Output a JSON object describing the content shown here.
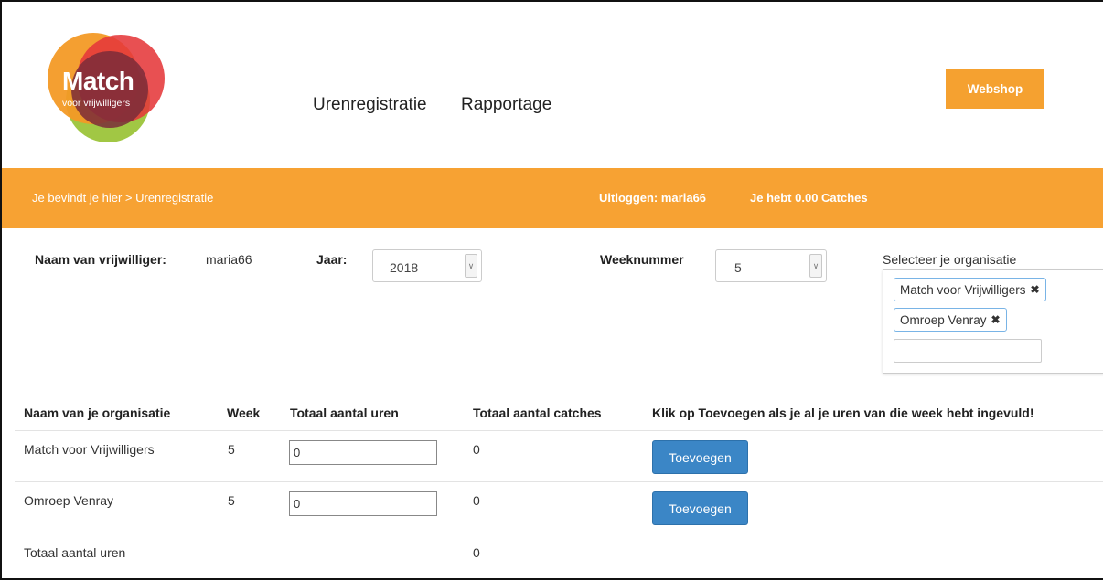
{
  "logo": {
    "main": "Match",
    "sub": "voor vrijwilligers"
  },
  "nav": {
    "items": [
      "Urenregistratie",
      "Rapportage"
    ]
  },
  "webshop_label": "Webshop",
  "bar": {
    "breadcrumb": "Je bevindt je hier > Urenregistratie",
    "logout": "Uitloggen: maria66",
    "catches": "Je hebt 0.00 Catches"
  },
  "form": {
    "volunteer_label": "Naam van vrijwilliger:",
    "volunteer_value": "maria66",
    "year_label": "Jaar:",
    "year_value": "2018",
    "week_label": "Weeknummer",
    "week_value": "5",
    "org_label": "Selecteer je organisatie",
    "org_tags": [
      "Match voor Vrijwilligers",
      "Omroep Venray"
    ]
  },
  "table": {
    "headers": [
      "Naam van je organisatie",
      "Week",
      "Totaal aantal uren",
      "Totaal aantal catches",
      "Klik op Toevoegen als je al je uren van die week hebt ingevuld!"
    ],
    "rows": [
      {
        "org": "Match voor Vrijwilligers",
        "week": "5",
        "hours": "0",
        "catches": "0",
        "button": "Toevoegen"
      },
      {
        "org": "Omroep Venray",
        "week": "5",
        "hours": "0",
        "catches": "0",
        "button": "Toevoegen"
      }
    ],
    "total_label": "Totaal aantal uren",
    "total_value": "0"
  },
  "colors": {
    "accent": "#f7a233",
    "button": "#3b86c6",
    "tag_border": "#79b4e6"
  },
  "icons": [
    "logo-circles",
    "chevron-down-icon",
    "remove-icon"
  ]
}
